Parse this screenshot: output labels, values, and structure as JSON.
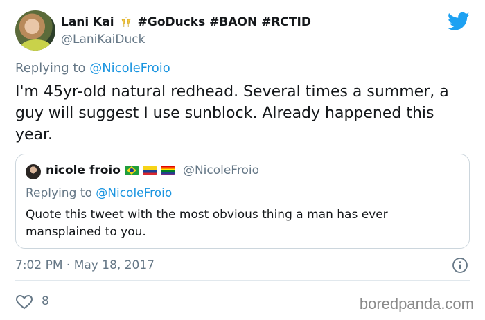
{
  "author": {
    "display_name": "Lani Kai",
    "emoji_icon": "clinking-glasses-icon",
    "hashtags": "#GoDucks #BAON #RCTID",
    "handle": "@LaniKaiDuck"
  },
  "brand_icon": "twitter-bird-icon",
  "reply": {
    "prefix": "Replying to",
    "mention": "@NicoleFroio"
  },
  "tweet_text": "I'm 45yr-old natural redhead. Several times a summer, a guy will suggest I use sunblock. Already happened this year.",
  "quoted": {
    "display_name": "nicole froio",
    "flags": [
      "brazil-flag-icon",
      "colombia-flag-icon",
      "pride-flag-icon"
    ],
    "handle": "@NicoleFroio",
    "reply_prefix": "Replying to",
    "reply_mention": "@NicoleFroio",
    "text": "Quote this tweet with the most obvious thing a man has ever mansplained to you."
  },
  "timestamp": "7:02 PM · May 18, 2017",
  "likes": "8",
  "watermark": "boredpanda.com",
  "colors": {
    "link": "#1b95e0",
    "secondary_text": "#657786",
    "twitter_blue": "#1da1f2",
    "border": "#ccd6dd"
  }
}
